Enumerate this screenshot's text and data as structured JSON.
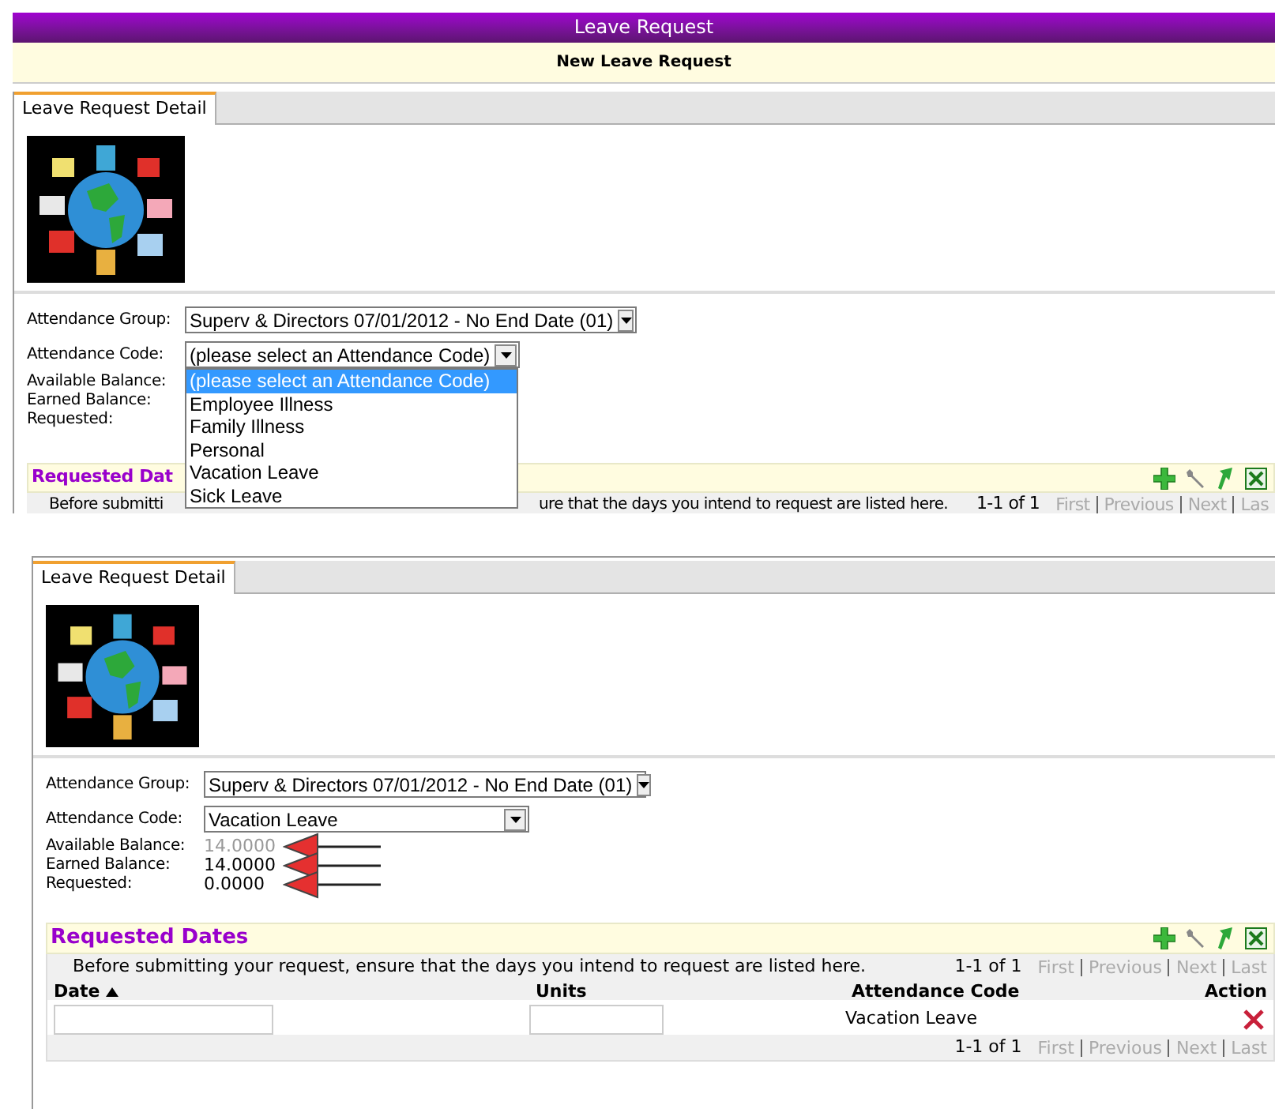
{
  "top_view": {
    "window_title": "Leave Request",
    "page_header": "New Leave Request",
    "tabs": [
      {
        "label": "Leave Request Detail",
        "selected": true
      }
    ],
    "fields": [
      {
        "label": "Attendance Group:",
        "value": "Superv & Directors 07/01/2012 - No End Date (01)"
      },
      {
        "label": "Attendance Code:",
        "value": "(please select an Attendance Code)",
        "options": [
          {
            "label": "(please select an Attendance Code)",
            "selected": true
          },
          {
            "label": "Employee Illness",
            "selected": false
          },
          {
            "label": "Family Illness",
            "selected": false
          },
          {
            "label": "Personal",
            "selected": false
          },
          {
            "label": "Vacation Leave",
            "selected": false
          },
          {
            "label": "Sick Leave",
            "selected": false
          }
        ]
      }
    ],
    "balances": [
      {
        "label": "Available Balance:"
      },
      {
        "label": "Earned Balance:"
      },
      {
        "label": "Requested:"
      }
    ],
    "requested_dates": {
      "title": "Requested Dat",
      "note_parts": [
        "Before submitti",
        "ure that the days you intend to request are listed here."
      ],
      "pager": {
        "range": "1-1 of 1",
        "links": [
          {
            "label": "First",
            "disabled": true
          },
          {
            "label": "Previous",
            "disabled": true
          },
          {
            "label": "Next",
            "disabled": true
          },
          {
            "label": "Las",
            "disabled": true
          }
        ]
      }
    }
  },
  "bottom_view": {
    "tabs": [
      {
        "label": "Leave Request Detail",
        "selected": true
      }
    ],
    "fields": [
      {
        "label": "Attendance Group:",
        "value": "Superv & Directors 07/01/2012 - No End Date (01)"
      },
      {
        "label": "Attendance Code:",
        "value": "Vacation Leave"
      }
    ],
    "balances": [
      {
        "label": "Available Balance:",
        "value": "14.0000",
        "dimmed": true,
        "annotated": true
      },
      {
        "label": "Earned Balance:",
        "value": "14.0000",
        "dimmed": false,
        "annotated": true
      },
      {
        "label": "Requested:",
        "value": "0.0000",
        "dimmed": false,
        "annotated": true
      }
    ],
    "requested_dates": {
      "title": "Requested Dates",
      "note": "Before submitting your request, ensure that the days you intend to request are listed here.",
      "pager": {
        "range": "1-1 of 1",
        "links": [
          {
            "label": "First",
            "disabled": true
          },
          {
            "label": "Previous",
            "disabled": true
          },
          {
            "label": "Next",
            "disabled": true
          },
          {
            "label": "Last",
            "disabled": true
          }
        ]
      },
      "columns": [
        {
          "label": "Date",
          "sorted": true
        },
        {
          "label": "Units",
          "sorted": false
        },
        {
          "label": "Attendance Code",
          "sorted": false
        },
        {
          "label": "Action",
          "sorted": false
        }
      ],
      "rows": [
        {
          "attendance_code": "Vacation Leave"
        }
      ],
      "footer_pager": {
        "range": "1-1 of 1",
        "links": [
          {
            "label": "First",
            "disabled": true
          },
          {
            "label": "Previous",
            "disabled": true
          },
          {
            "label": "Next",
            "disabled": true
          },
          {
            "label": "Last",
            "disabled": true
          }
        ]
      }
    }
  }
}
